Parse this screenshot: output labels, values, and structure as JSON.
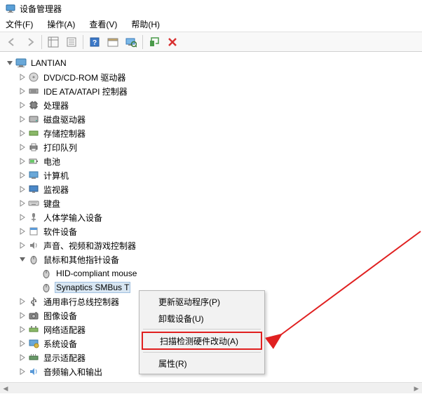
{
  "window": {
    "title": "设备管理器"
  },
  "menu": {
    "file": "文件(F)",
    "action": "操作(A)",
    "view": "查看(V)",
    "help": "帮助(H)"
  },
  "tree": {
    "root": "LANTIAN",
    "items": [
      "DVD/CD-ROM 驱动器",
      "IDE ATA/ATAPI 控制器",
      "处理器",
      "磁盘驱动器",
      "存储控制器",
      "打印队列",
      "电池",
      "计算机",
      "监视器",
      "键盘",
      "人体学输入设备",
      "软件设备",
      "声音、视频和游戏控制器",
      "鼠标和其他指针设备",
      "通用串行总线控制器",
      "图像设备",
      "网络适配器",
      "系统设备",
      "显示适配器",
      "音频输入和输出"
    ],
    "mice_children": [
      "HID-compliant mouse",
      "Synaptics SMBus T"
    ]
  },
  "context_menu": {
    "update": "更新驱动程序(P)",
    "uninstall": "卸载设备(U)",
    "scan": "扫描检测硬件改动(A)",
    "properties": "属性(R)"
  }
}
